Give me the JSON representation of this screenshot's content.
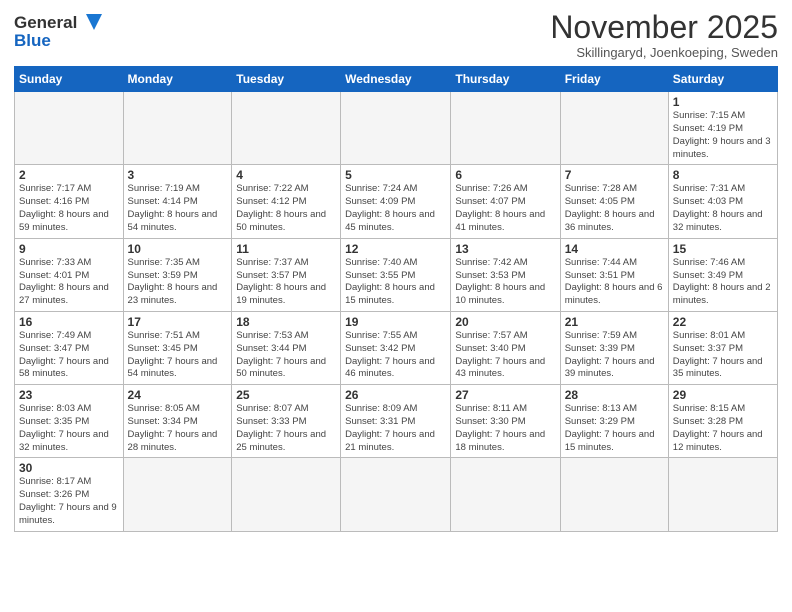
{
  "header": {
    "logo_general": "General",
    "logo_blue": "Blue",
    "month": "November 2025",
    "location": "Skillingaryd, Joenkoeping, Sweden"
  },
  "weekdays": [
    "Sunday",
    "Monday",
    "Tuesday",
    "Wednesday",
    "Thursday",
    "Friday",
    "Saturday"
  ],
  "weeks": [
    [
      {
        "day": "",
        "info": ""
      },
      {
        "day": "",
        "info": ""
      },
      {
        "day": "",
        "info": ""
      },
      {
        "day": "",
        "info": ""
      },
      {
        "day": "",
        "info": ""
      },
      {
        "day": "",
        "info": ""
      },
      {
        "day": "1",
        "info": "Sunrise: 7:15 AM\nSunset: 4:19 PM\nDaylight: 9 hours and 3 minutes."
      }
    ],
    [
      {
        "day": "2",
        "info": "Sunrise: 7:17 AM\nSunset: 4:16 PM\nDaylight: 8 hours and 59 minutes."
      },
      {
        "day": "3",
        "info": "Sunrise: 7:19 AM\nSunset: 4:14 PM\nDaylight: 8 hours and 54 minutes."
      },
      {
        "day": "4",
        "info": "Sunrise: 7:22 AM\nSunset: 4:12 PM\nDaylight: 8 hours and 50 minutes."
      },
      {
        "day": "5",
        "info": "Sunrise: 7:24 AM\nSunset: 4:09 PM\nDaylight: 8 hours and 45 minutes."
      },
      {
        "day": "6",
        "info": "Sunrise: 7:26 AM\nSunset: 4:07 PM\nDaylight: 8 hours and 41 minutes."
      },
      {
        "day": "7",
        "info": "Sunrise: 7:28 AM\nSunset: 4:05 PM\nDaylight: 8 hours and 36 minutes."
      },
      {
        "day": "8",
        "info": "Sunrise: 7:31 AM\nSunset: 4:03 PM\nDaylight: 8 hours and 32 minutes."
      }
    ],
    [
      {
        "day": "9",
        "info": "Sunrise: 7:33 AM\nSunset: 4:01 PM\nDaylight: 8 hours and 27 minutes."
      },
      {
        "day": "10",
        "info": "Sunrise: 7:35 AM\nSunset: 3:59 PM\nDaylight: 8 hours and 23 minutes."
      },
      {
        "day": "11",
        "info": "Sunrise: 7:37 AM\nSunset: 3:57 PM\nDaylight: 8 hours and 19 minutes."
      },
      {
        "day": "12",
        "info": "Sunrise: 7:40 AM\nSunset: 3:55 PM\nDaylight: 8 hours and 15 minutes."
      },
      {
        "day": "13",
        "info": "Sunrise: 7:42 AM\nSunset: 3:53 PM\nDaylight: 8 hours and 10 minutes."
      },
      {
        "day": "14",
        "info": "Sunrise: 7:44 AM\nSunset: 3:51 PM\nDaylight: 8 hours and 6 minutes."
      },
      {
        "day": "15",
        "info": "Sunrise: 7:46 AM\nSunset: 3:49 PM\nDaylight: 8 hours and 2 minutes."
      }
    ],
    [
      {
        "day": "16",
        "info": "Sunrise: 7:49 AM\nSunset: 3:47 PM\nDaylight: 7 hours and 58 minutes."
      },
      {
        "day": "17",
        "info": "Sunrise: 7:51 AM\nSunset: 3:45 PM\nDaylight: 7 hours and 54 minutes."
      },
      {
        "day": "18",
        "info": "Sunrise: 7:53 AM\nSunset: 3:44 PM\nDaylight: 7 hours and 50 minutes."
      },
      {
        "day": "19",
        "info": "Sunrise: 7:55 AM\nSunset: 3:42 PM\nDaylight: 7 hours and 46 minutes."
      },
      {
        "day": "20",
        "info": "Sunrise: 7:57 AM\nSunset: 3:40 PM\nDaylight: 7 hours and 43 minutes."
      },
      {
        "day": "21",
        "info": "Sunrise: 7:59 AM\nSunset: 3:39 PM\nDaylight: 7 hours and 39 minutes."
      },
      {
        "day": "22",
        "info": "Sunrise: 8:01 AM\nSunset: 3:37 PM\nDaylight: 7 hours and 35 minutes."
      }
    ],
    [
      {
        "day": "23",
        "info": "Sunrise: 8:03 AM\nSunset: 3:35 PM\nDaylight: 7 hours and 32 minutes."
      },
      {
        "day": "24",
        "info": "Sunrise: 8:05 AM\nSunset: 3:34 PM\nDaylight: 7 hours and 28 minutes."
      },
      {
        "day": "25",
        "info": "Sunrise: 8:07 AM\nSunset: 3:33 PM\nDaylight: 7 hours and 25 minutes."
      },
      {
        "day": "26",
        "info": "Sunrise: 8:09 AM\nSunset: 3:31 PM\nDaylight: 7 hours and 21 minutes."
      },
      {
        "day": "27",
        "info": "Sunrise: 8:11 AM\nSunset: 3:30 PM\nDaylight: 7 hours and 18 minutes."
      },
      {
        "day": "28",
        "info": "Sunrise: 8:13 AM\nSunset: 3:29 PM\nDaylight: 7 hours and 15 minutes."
      },
      {
        "day": "29",
        "info": "Sunrise: 8:15 AM\nSunset: 3:28 PM\nDaylight: 7 hours and 12 minutes."
      }
    ],
    [
      {
        "day": "30",
        "info": "Sunrise: 8:17 AM\nSunset: 3:26 PM\nDaylight: 7 hours and 9 minutes."
      },
      {
        "day": "",
        "info": ""
      },
      {
        "day": "",
        "info": ""
      },
      {
        "day": "",
        "info": ""
      },
      {
        "day": "",
        "info": ""
      },
      {
        "day": "",
        "info": ""
      },
      {
        "day": "",
        "info": ""
      }
    ]
  ]
}
